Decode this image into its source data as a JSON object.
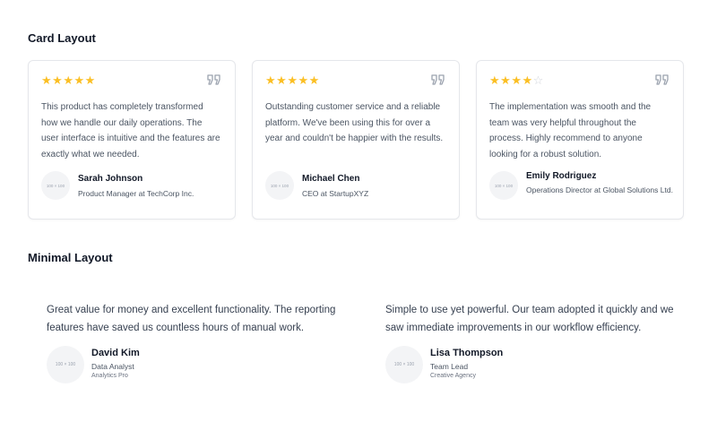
{
  "card_section": {
    "title": "Card Layout",
    "cards": [
      {
        "rating": 5,
        "text": "This product has completely transformed how we handle our daily operations. The user interface is intuitive and the features are exactly what we needed.",
        "avatar": "100 × 100",
        "name": "Sarah Johnson",
        "role": "Product Manager at TechCorp Inc."
      },
      {
        "rating": 5,
        "text": "Outstanding customer service and a reliable platform. We've been using this for over a year and couldn't be happier with the results.",
        "avatar": "100 × 100",
        "name": "Michael Chen",
        "role": "CEO at StartupXYZ"
      },
      {
        "rating": 4,
        "text": "The implementation was smooth and the team was very helpful throughout the process. Highly recommend to anyone looking for a robust solution.",
        "avatar": "100 × 100",
        "name": "Emily Rodriguez",
        "role": "Operations Director at Global Solutions Ltd."
      }
    ]
  },
  "minimal_section": {
    "title": "Minimal Layout",
    "items": [
      {
        "text": "Great value for money and excellent functionality. The reporting features have saved us countless hours of manual work.",
        "avatar": "100 × 100",
        "name": "David Kim",
        "role": "Data Analyst",
        "company": "Analytics Pro"
      },
      {
        "text": "Simple to use yet powerful. Our team adopted it quickly and we saw immediate improvements in our workflow efficiency.",
        "avatar": "100 × 100",
        "name": "Lisa Thompson",
        "role": "Team Lead",
        "company": "Creative Agency"
      }
    ]
  },
  "colors": {
    "star_filled": "#fbbf24",
    "star_empty": "#d1d5db",
    "quote_icon": "#9ca3af"
  },
  "icons": {
    "rating": "star-icon",
    "quote": "quote-icon"
  }
}
